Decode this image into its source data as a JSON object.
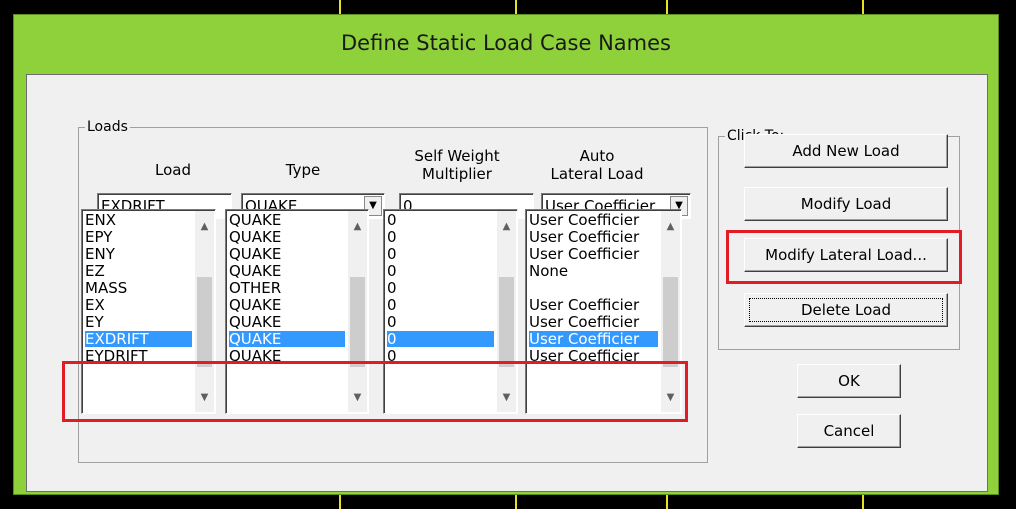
{
  "dialog": {
    "title": "Define Static Load Case Names"
  },
  "loads_group": {
    "legend": "Loads",
    "headers": {
      "load": "Load",
      "type": "Type",
      "self_weight_1": "Self Weight",
      "self_weight_2": "Multiplier",
      "auto_1": "Auto",
      "auto_2": "Lateral Load"
    },
    "current": {
      "load": "EXDRIFT",
      "type": "QUAKE",
      "multiplier": "0",
      "auto": "User Coefficier"
    },
    "rows": [
      {
        "load": "ENX",
        "type": "QUAKE",
        "multiplier": "0",
        "auto": "User Coefficier"
      },
      {
        "load": "EPY",
        "type": "QUAKE",
        "multiplier": "0",
        "auto": "User Coefficier"
      },
      {
        "load": "ENY",
        "type": "QUAKE",
        "multiplier": "0",
        "auto": "User Coefficier"
      },
      {
        "load": "EZ",
        "type": "QUAKE",
        "multiplier": "0",
        "auto": "None"
      },
      {
        "load": "MASS",
        "type": "OTHER",
        "multiplier": "0",
        "auto": ""
      },
      {
        "load": "EX",
        "type": "QUAKE",
        "multiplier": "0",
        "auto": "User Coefficier"
      },
      {
        "load": "EY",
        "type": "QUAKE",
        "multiplier": "0",
        "auto": "User Coefficier"
      },
      {
        "load": "EXDRIFT",
        "type": "QUAKE",
        "multiplier": "0",
        "auto": "User Coefficier"
      },
      {
        "load": "EYDRIFT",
        "type": "QUAKE",
        "multiplier": "0",
        "auto": "User Coefficier"
      }
    ],
    "selected_row": 7
  },
  "click_group": {
    "legend": "Click To:",
    "add": "Add New Load",
    "modify": "Modify Load",
    "modify_lateral": "Modify Lateral Load...",
    "delete": "Delete Load"
  },
  "footer": {
    "ok": "OK",
    "cancel": "Cancel"
  },
  "colors": {
    "frame": "#8fd13a",
    "highlight": "#e01c24",
    "selection": "#3399ff"
  }
}
